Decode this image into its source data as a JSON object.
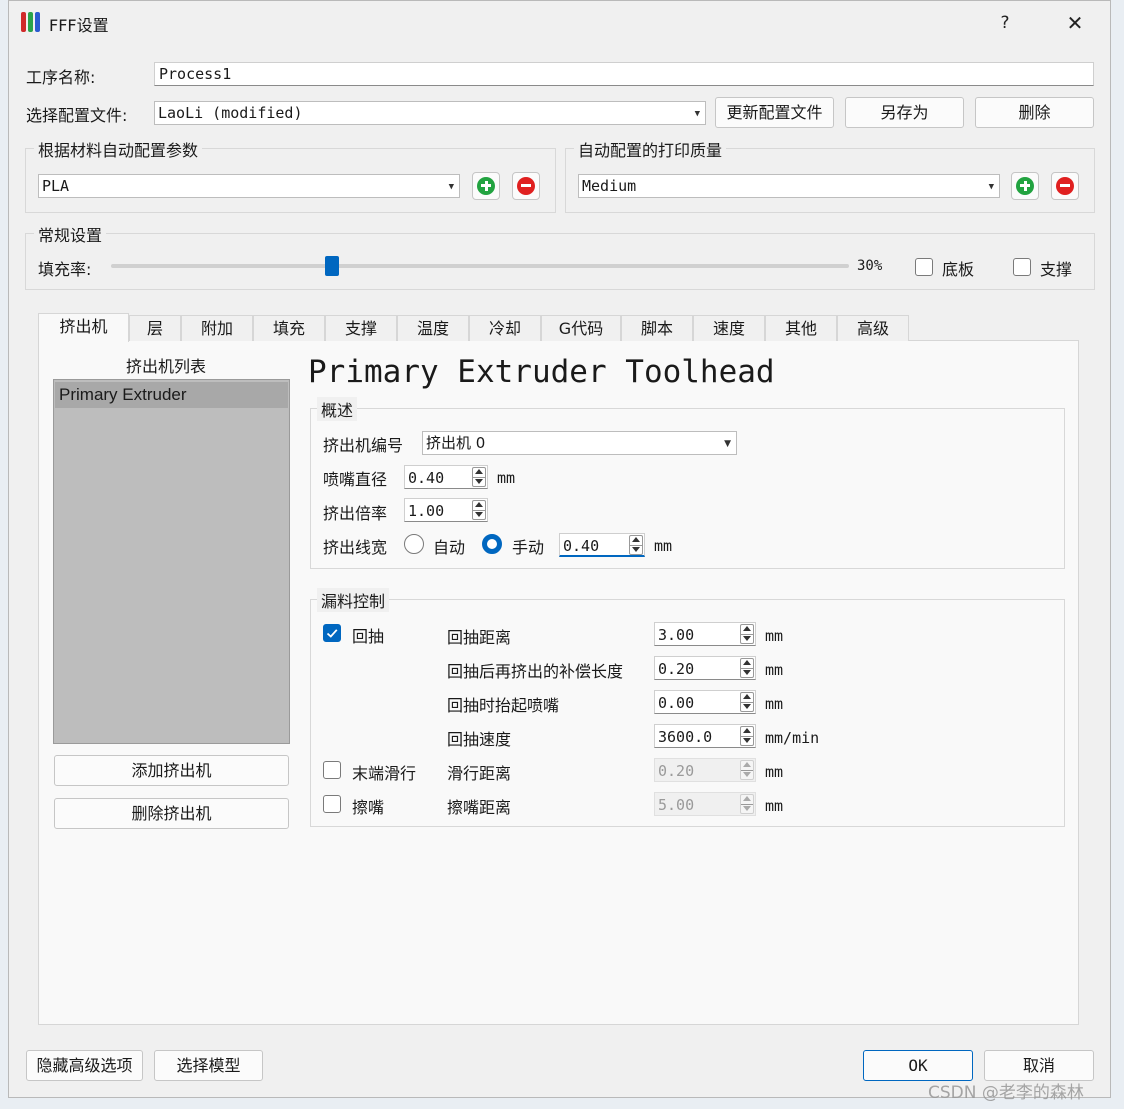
{
  "window": {
    "title": "FFF设置",
    "help": "?",
    "close": "✕"
  },
  "process": {
    "label": "工序名称:",
    "value": "Process1"
  },
  "profile": {
    "label": "选择配置文件:",
    "value": "LaoLi (modified)",
    "update_button": "更新配置文件",
    "saveas_button": "另存为",
    "delete_button": "删除"
  },
  "material_group": {
    "title": "根据材料自动配置参数",
    "value": "PLA"
  },
  "quality_group": {
    "title": "自动配置的打印质量",
    "value": "Medium"
  },
  "general": {
    "title": "常规设置",
    "infill_label": "填充率:",
    "infill_value": "30%",
    "infill_fraction": 0.3,
    "raft_label": "底板",
    "support_label": "支撑"
  },
  "tabs": [
    "挤出机",
    "层",
    "附加",
    "填充",
    "支撑",
    "温度",
    "冷却",
    "G代码",
    "脚本",
    "速度",
    "其他",
    "高级"
  ],
  "extruder_list": {
    "title": "挤出机列表",
    "items": [
      "Primary Extruder"
    ],
    "add_button": "添加挤出机",
    "remove_button": "删除挤出机"
  },
  "toolhead": {
    "heading": "Primary Extruder Toolhead",
    "overview": {
      "title": "概述",
      "number_label": "挤出机编号",
      "number_value": "挤出机 0",
      "nozzle_label": "喷嘴直径",
      "nozzle_value": "0.40",
      "nozzle_unit": "mm",
      "multiplier_label": "挤出倍率",
      "multiplier_value": "1.00",
      "width_label": "挤出线宽",
      "auto_label": "自动",
      "manual_label": "手动",
      "width_value": "0.40",
      "width_unit": "mm"
    },
    "ooze": {
      "title": "漏料控制",
      "retract_label": "回抽",
      "retract_distance_label": "回抽距离",
      "retract_distance_value": "3.00",
      "retract_distance_unit": "mm",
      "extra_restart_label": "回抽后再挤出的补偿长度",
      "extra_restart_value": "0.20",
      "extra_restart_unit": "mm",
      "lift_label": "回抽时抬起喷嘴",
      "lift_value": "0.00",
      "lift_unit": "mm",
      "speed_label": "回抽速度",
      "speed_value": "3600.0",
      "speed_unit": "mm/min",
      "coast_label": "末端滑行",
      "coast_distance_label": "滑行距离",
      "coast_distance_value": "0.20",
      "coast_unit": "mm",
      "wipe_label": "擦嘴",
      "wipe_distance_label": "擦嘴距离",
      "wipe_distance_value": "5.00",
      "wipe_unit": "mm"
    }
  },
  "footer": {
    "hide_advanced": "隐藏高级选项",
    "select_models": "选择模型",
    "ok": "OK",
    "cancel": "取消"
  },
  "watermark": "CSDN @老李的森林",
  "colors": {
    "accent": "#0067c0",
    "add": "#22a340",
    "remove": "#e02020"
  }
}
